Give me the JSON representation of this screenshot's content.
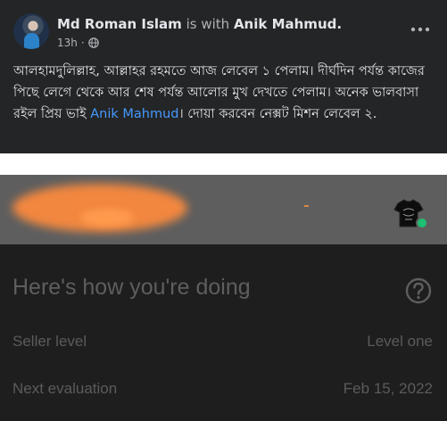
{
  "post": {
    "author": "Md Roman Islam",
    "with_word": "is with",
    "tagged": "Anik Mahmud.",
    "time": "13h",
    "body_before_mention": "আলহামদুলিল্লাহ,  আল্লাহর রহমতে আজ লেবেল ১ পেলাম। দীর্ঘদিন পর্যন্ত কাজের পিছে লেগে থেকে আর শেষ পর্যন্ত আলোর মুখ দেখতে পেলাম। অনেক ভালবাসা রইল প্রিয় ভাই ",
    "mention": "Anik Mahmud",
    "body_after_mention": "। দোয়া করবেন নেক্সট মিশন লেবেল ২."
  },
  "icons": {
    "avatar": "avatar",
    "globe": "globe-icon",
    "more": "more-options-icon",
    "shirt": "t-shirt-icon",
    "help": "question-mark-icon"
  },
  "card": {
    "title": "Here's how you're doing",
    "rows": [
      {
        "label": "Seller level",
        "value": "Level one"
      },
      {
        "label": "Next evaluation",
        "value": "Feb 15, 2022"
      }
    ]
  },
  "colors": {
    "mention": "#4599ff",
    "background": "#242526",
    "redaction": "#ff8b3d",
    "status_online": "#1dbf73"
  }
}
